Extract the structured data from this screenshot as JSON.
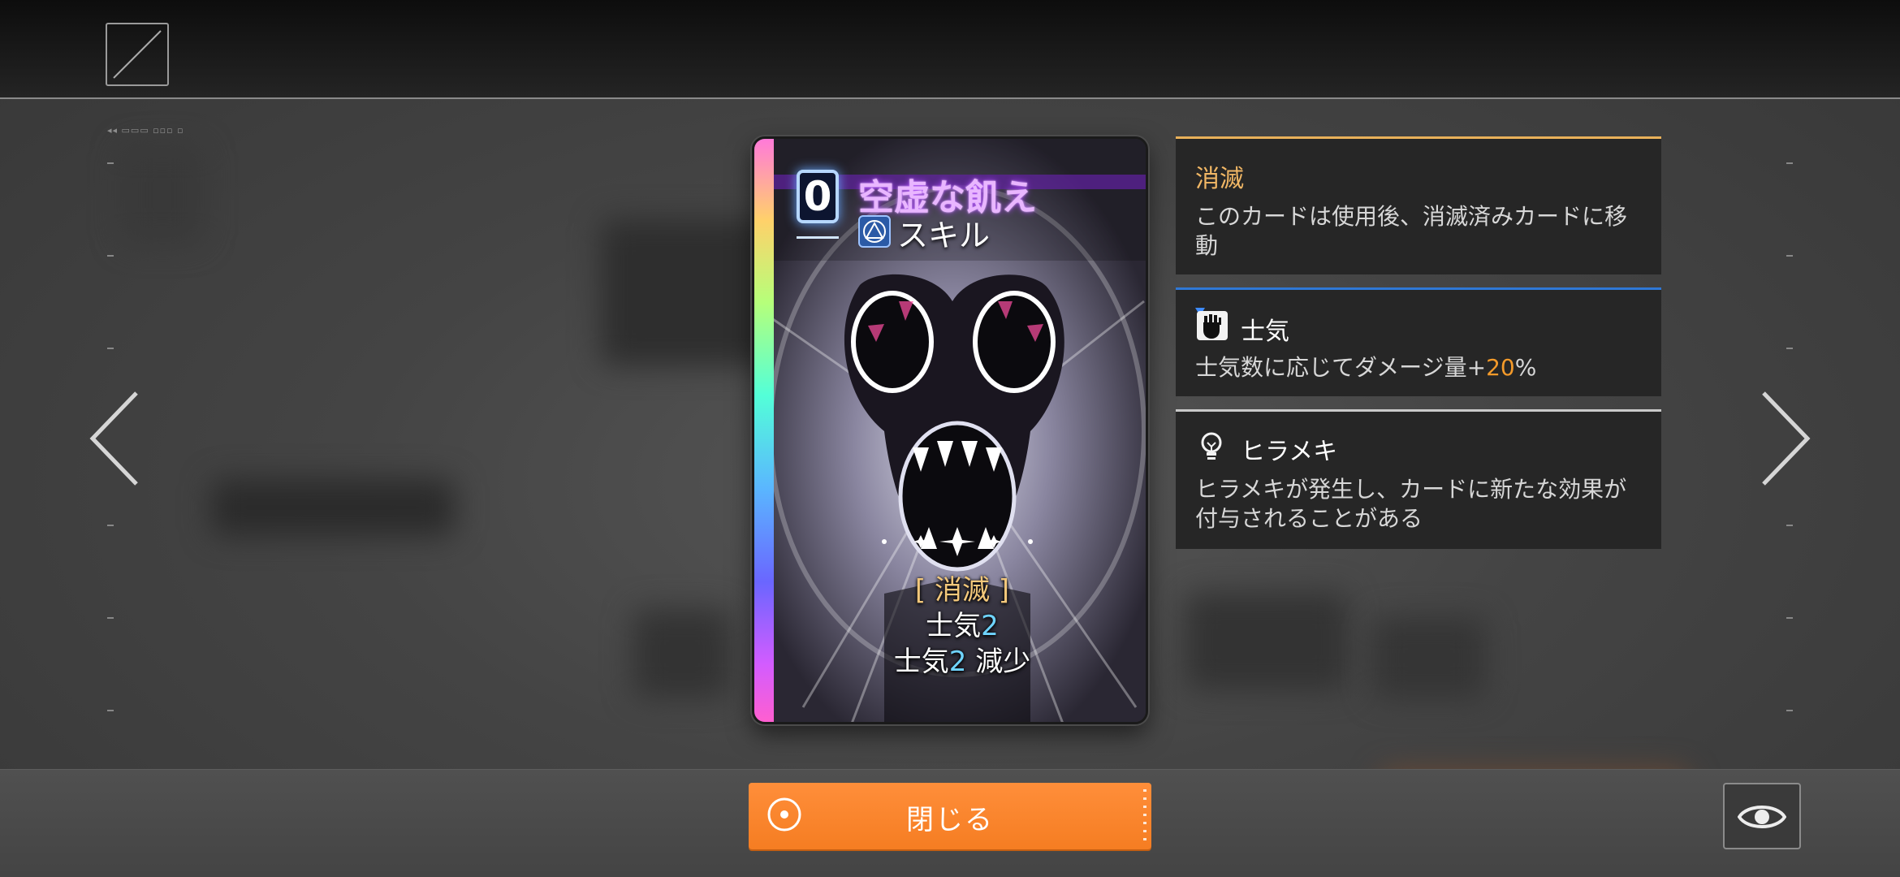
{
  "card": {
    "cost": "0",
    "name": "空虚な飢え",
    "type": "スキル",
    "type_icon": "skill-triangle-icon",
    "keyword": "[ 消滅 ]",
    "line2": {
      "prefix": "士気",
      "value": "2",
      "suffix": ""
    },
    "line3": {
      "prefix": "士気",
      "value": "2",
      "suffix": " 減少"
    }
  },
  "info_panels": [
    {
      "title": "消滅",
      "description": "このカードは使用後、消滅済みカードに移動",
      "accent": "#e9b15a"
    },
    {
      "title": "士気",
      "icon": "morale-fist-icon",
      "description_prefix": "士気数に応じてダメージ量+",
      "description_value": "20",
      "description_suffix": "%",
      "accent": "#2f78d6"
    },
    {
      "title": "ヒラメキ",
      "icon": "lightbulb-icon",
      "description": "ヒラメキが発生し、カードに新たな効果が付与されることがある",
      "accent": "#c9c9c9"
    }
  ],
  "controls": {
    "close_label": "閉じる",
    "close_accent": "#f57d22"
  },
  "icons": {
    "menu": "menu-box-icon",
    "prev": "chevron-left-icon",
    "next": "chevron-right-icon",
    "view": "eye-icon",
    "close_circle": "circle-target-icon"
  }
}
